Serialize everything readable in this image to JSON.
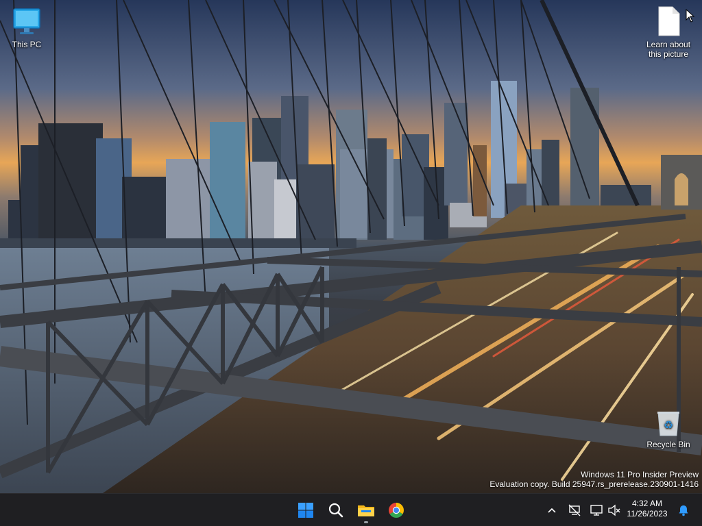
{
  "desktop": {
    "icons": [
      {
        "label": "This PC",
        "icon": "this-pc-monitor-icon"
      },
      {
        "label": "Learn about this picture",
        "icon": "document-icon"
      },
      {
        "label": "Recycle Bin",
        "icon": "recycle-bin-icon"
      }
    ],
    "watermark": {
      "line1": "Windows 11 Pro Insider Preview",
      "line2": "Evaluation copy. Build 25947.rs_prerelease.230901-1416"
    }
  },
  "taskbar": {
    "apps": [
      {
        "name": "Start",
        "icon": "windows-start-icon"
      },
      {
        "name": "Search",
        "icon": "search-icon"
      },
      {
        "name": "File Explorer",
        "icon": "folder-icon",
        "running": true
      },
      {
        "name": "Google Chrome",
        "icon": "chrome-icon",
        "running": false
      }
    ],
    "tray": {
      "icons": [
        "chevron-up-icon",
        "network-disconnected-icon",
        "display-icon",
        "volume-muted-icon",
        "notification-bell-icon"
      ]
    },
    "clock": {
      "time": "4:32 AM",
      "date": "11/26/2023"
    }
  },
  "colors": {
    "taskbar_bg": "#1f1f22",
    "accent_blue": "#0a84ff"
  }
}
